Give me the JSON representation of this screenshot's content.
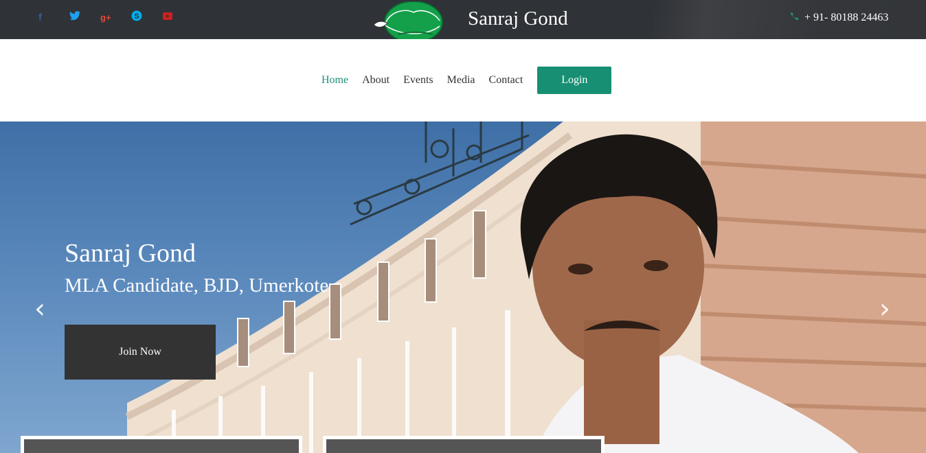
{
  "social": [
    {
      "name": "facebook-icon",
      "glyph": "f"
    },
    {
      "name": "twitter-icon",
      "glyph": "🐦"
    },
    {
      "name": "google-plus-icon",
      "glyph": "g+"
    },
    {
      "name": "skype-icon",
      "glyph": "S"
    },
    {
      "name": "youtube-icon",
      "glyph": "▶"
    }
  ],
  "brand": "Sanraj Gond",
  "phone": "+ 91- 80188 24463",
  "nav": {
    "items": [
      {
        "label": "Home",
        "active": true
      },
      {
        "label": "About",
        "active": false
      },
      {
        "label": "Events",
        "active": false
      },
      {
        "label": "Media",
        "active": false
      },
      {
        "label": "Contact",
        "active": false
      }
    ],
    "login_label": "Login"
  },
  "hero": {
    "title": "Sanraj Gond",
    "subtitle": "MLA Candidate, BJD, Umerkote",
    "cta_label": "Join Now",
    "prev_glyph": "‹",
    "next_glyph": "›"
  },
  "colors": {
    "topbar": "#2f3237",
    "accent": "#178f72",
    "cta": "#333333"
  }
}
